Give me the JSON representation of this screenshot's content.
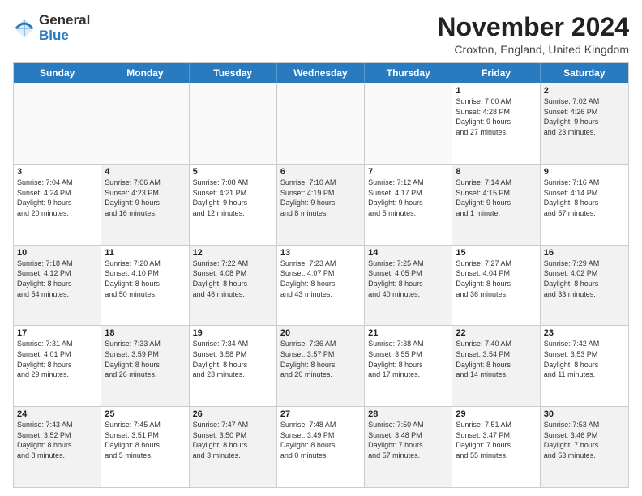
{
  "header": {
    "logo_line1": "General",
    "logo_line2": "Blue",
    "month": "November 2024",
    "location": "Croxton, England, United Kingdom"
  },
  "days_of_week": [
    "Sunday",
    "Monday",
    "Tuesday",
    "Wednesday",
    "Thursday",
    "Friday",
    "Saturday"
  ],
  "weeks": [
    [
      {
        "day": "",
        "empty": true
      },
      {
        "day": "",
        "empty": true
      },
      {
        "day": "",
        "empty": true
      },
      {
        "day": "",
        "empty": true
      },
      {
        "day": "",
        "empty": true
      },
      {
        "day": "1",
        "info": "Sunrise: 7:00 AM\nSunset: 4:28 PM\nDaylight: 9 hours\nand 27 minutes."
      },
      {
        "day": "2",
        "info": "Sunrise: 7:02 AM\nSunset: 4:26 PM\nDaylight: 9 hours\nand 23 minutes.",
        "shaded": true
      }
    ],
    [
      {
        "day": "3",
        "info": "Sunrise: 7:04 AM\nSunset: 4:24 PM\nDaylight: 9 hours\nand 20 minutes."
      },
      {
        "day": "4",
        "info": "Sunrise: 7:06 AM\nSunset: 4:23 PM\nDaylight: 9 hours\nand 16 minutes.",
        "shaded": true
      },
      {
        "day": "5",
        "info": "Sunrise: 7:08 AM\nSunset: 4:21 PM\nDaylight: 9 hours\nand 12 minutes."
      },
      {
        "day": "6",
        "info": "Sunrise: 7:10 AM\nSunset: 4:19 PM\nDaylight: 9 hours\nand 8 minutes.",
        "shaded": true
      },
      {
        "day": "7",
        "info": "Sunrise: 7:12 AM\nSunset: 4:17 PM\nDaylight: 9 hours\nand 5 minutes."
      },
      {
        "day": "8",
        "info": "Sunrise: 7:14 AM\nSunset: 4:15 PM\nDaylight: 9 hours\nand 1 minute.",
        "shaded": true
      },
      {
        "day": "9",
        "info": "Sunrise: 7:16 AM\nSunset: 4:14 PM\nDaylight: 8 hours\nand 57 minutes."
      }
    ],
    [
      {
        "day": "10",
        "info": "Sunrise: 7:18 AM\nSunset: 4:12 PM\nDaylight: 8 hours\nand 54 minutes.",
        "shaded": true
      },
      {
        "day": "11",
        "info": "Sunrise: 7:20 AM\nSunset: 4:10 PM\nDaylight: 8 hours\nand 50 minutes."
      },
      {
        "day": "12",
        "info": "Sunrise: 7:22 AM\nSunset: 4:08 PM\nDaylight: 8 hours\nand 46 minutes.",
        "shaded": true
      },
      {
        "day": "13",
        "info": "Sunrise: 7:23 AM\nSunset: 4:07 PM\nDaylight: 8 hours\nand 43 minutes."
      },
      {
        "day": "14",
        "info": "Sunrise: 7:25 AM\nSunset: 4:05 PM\nDaylight: 8 hours\nand 40 minutes.",
        "shaded": true
      },
      {
        "day": "15",
        "info": "Sunrise: 7:27 AM\nSunset: 4:04 PM\nDaylight: 8 hours\nand 36 minutes."
      },
      {
        "day": "16",
        "info": "Sunrise: 7:29 AM\nSunset: 4:02 PM\nDaylight: 8 hours\nand 33 minutes.",
        "shaded": true
      }
    ],
    [
      {
        "day": "17",
        "info": "Sunrise: 7:31 AM\nSunset: 4:01 PM\nDaylight: 8 hours\nand 29 minutes."
      },
      {
        "day": "18",
        "info": "Sunrise: 7:33 AM\nSunset: 3:59 PM\nDaylight: 8 hours\nand 26 minutes.",
        "shaded": true
      },
      {
        "day": "19",
        "info": "Sunrise: 7:34 AM\nSunset: 3:58 PM\nDaylight: 8 hours\nand 23 minutes."
      },
      {
        "day": "20",
        "info": "Sunrise: 7:36 AM\nSunset: 3:57 PM\nDaylight: 8 hours\nand 20 minutes.",
        "shaded": true
      },
      {
        "day": "21",
        "info": "Sunrise: 7:38 AM\nSunset: 3:55 PM\nDaylight: 8 hours\nand 17 minutes."
      },
      {
        "day": "22",
        "info": "Sunrise: 7:40 AM\nSunset: 3:54 PM\nDaylight: 8 hours\nand 14 minutes.",
        "shaded": true
      },
      {
        "day": "23",
        "info": "Sunrise: 7:42 AM\nSunset: 3:53 PM\nDaylight: 8 hours\nand 11 minutes."
      }
    ],
    [
      {
        "day": "24",
        "info": "Sunrise: 7:43 AM\nSunset: 3:52 PM\nDaylight: 8 hours\nand 8 minutes.",
        "shaded": true
      },
      {
        "day": "25",
        "info": "Sunrise: 7:45 AM\nSunset: 3:51 PM\nDaylight: 8 hours\nand 5 minutes."
      },
      {
        "day": "26",
        "info": "Sunrise: 7:47 AM\nSunset: 3:50 PM\nDaylight: 8 hours\nand 3 minutes.",
        "shaded": true
      },
      {
        "day": "27",
        "info": "Sunrise: 7:48 AM\nSunset: 3:49 PM\nDaylight: 8 hours\nand 0 minutes."
      },
      {
        "day": "28",
        "info": "Sunrise: 7:50 AM\nSunset: 3:48 PM\nDaylight: 7 hours\nand 57 minutes.",
        "shaded": true
      },
      {
        "day": "29",
        "info": "Sunrise: 7:51 AM\nSunset: 3:47 PM\nDaylight: 7 hours\nand 55 minutes."
      },
      {
        "day": "30",
        "info": "Sunrise: 7:53 AM\nSunset: 3:46 PM\nDaylight: 7 hours\nand 53 minutes.",
        "shaded": true
      }
    ]
  ]
}
